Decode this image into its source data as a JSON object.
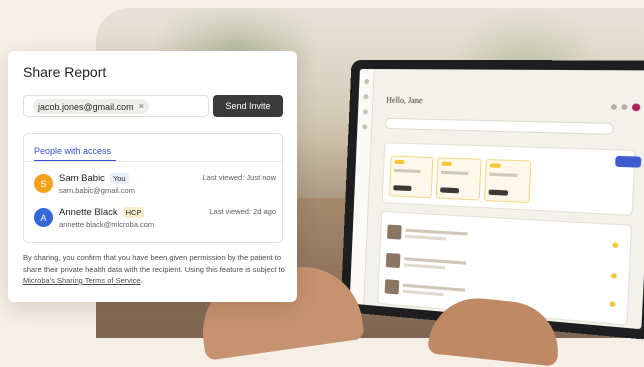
{
  "dialog": {
    "title": "Share Report",
    "invite_chip_email": "jacob.jones@gmail.com",
    "chip_remove_glyph": "×",
    "send_button_label": "Send Invite",
    "access_tab_label": "People with access",
    "people": [
      {
        "initial": "S",
        "name": "Sam Babic",
        "badge": "You",
        "badge_color": "#e8ecfb",
        "avatar_color": "#f2a21b",
        "email": "sam.babic@gmail.com",
        "last_viewed": "Last viewed: Just now"
      },
      {
        "initial": "A",
        "name": "Annette Black",
        "badge": "HCP",
        "badge_color": "#f7edc9",
        "avatar_color": "#3368d6",
        "email": "annette.black@microba.com",
        "last_viewed": "Last viewed: 2d ago"
      }
    ],
    "disclaimer_text": "By sharing, you confirm that you have been given permission by the patient to share their private health data with the recipient. Using this feature is subject to ",
    "disclaimer_link": "Microba's Sharing Terms of Service",
    "disclaimer_end": "."
  },
  "background_app": {
    "greeting": "Hello, Jane"
  },
  "colors": {
    "accent": "#3550c8",
    "send_button": "#3b3b3c"
  }
}
